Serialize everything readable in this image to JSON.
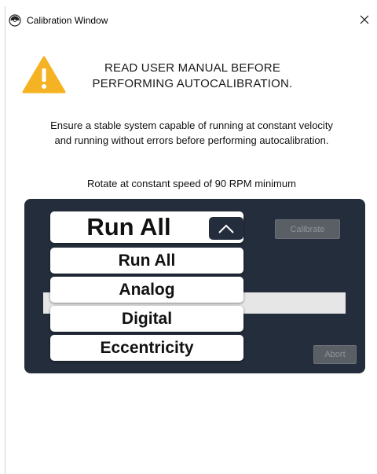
{
  "window": {
    "title": "Calibration Window",
    "close_glyph": "✕"
  },
  "warning": {
    "icon": "warning-triangle-icon",
    "color": "#F5B324",
    "line1": "READ USER MANUAL BEFORE",
    "line2": "PERFORMING AUTOCALIBRATION."
  },
  "instructions": {
    "line1": "Ensure a stable system capable of running at constant velocity",
    "line2": "and running without errors before performing autocalibration."
  },
  "speed_instruction": "Rotate at constant speed of 90 RPM minimum",
  "panel": {
    "background": "#242D3B",
    "dropdown": {
      "selected": "Run All",
      "options": [
        "Run All",
        "Analog",
        "Digital",
        "Eccentricity"
      ]
    },
    "calibrate_label": "Calibrate",
    "abort_label": "Abort"
  }
}
